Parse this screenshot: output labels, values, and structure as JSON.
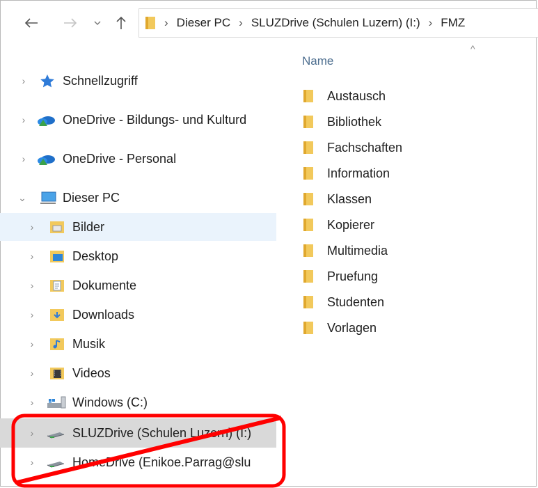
{
  "nav": {
    "back_icon": "arrow-left-icon",
    "forward_icon": "arrow-right-icon",
    "recent_icon": "chevron-down-icon",
    "up_icon": "arrow-up-icon"
  },
  "address": {
    "crumbs": [
      "Dieser PC",
      "SLUZDrive (Schulen Luzern) (I:)",
      "FMZ"
    ]
  },
  "tree": {
    "items": [
      {
        "label": "Schnellzugriff",
        "icon": "star-icon"
      },
      {
        "label": "OneDrive - Bildungs- und Kulturd",
        "icon": "onedrive-icon"
      },
      {
        "label": "OneDrive - Personal",
        "icon": "onedrive-icon"
      },
      {
        "label": "Dieser PC",
        "icon": "computer-icon"
      },
      {
        "label": "Bilder",
        "icon": "pictures-folder-icon"
      },
      {
        "label": "Desktop",
        "icon": "desktop-folder-icon"
      },
      {
        "label": "Dokumente",
        "icon": "documents-folder-icon"
      },
      {
        "label": "Downloads",
        "icon": "downloads-folder-icon"
      },
      {
        "label": "Musik",
        "icon": "music-folder-icon"
      },
      {
        "label": "Videos",
        "icon": "videos-folder-icon"
      },
      {
        "label": "Windows (C:)",
        "icon": "windows-drive-icon"
      },
      {
        "label": "SLUZDrive (Schulen Luzern) (I:)",
        "icon": "network-drive-icon"
      },
      {
        "label": "HomeDrive (Enikoe.Parrag@slu",
        "icon": "network-drive-icon"
      }
    ]
  },
  "list": {
    "column_name": "Name",
    "folders": [
      "Austausch",
      "Bibliothek",
      "Fachschaften",
      "Information",
      "Klassen",
      "Kopierer",
      "Multimedia",
      "Pruefung",
      "Studenten",
      "Vorlagen"
    ]
  },
  "colors": {
    "selection": "#eaf3fc",
    "hover": "#d9d9d9",
    "annotation": "#ff0000",
    "folder": "#f2c95c"
  }
}
